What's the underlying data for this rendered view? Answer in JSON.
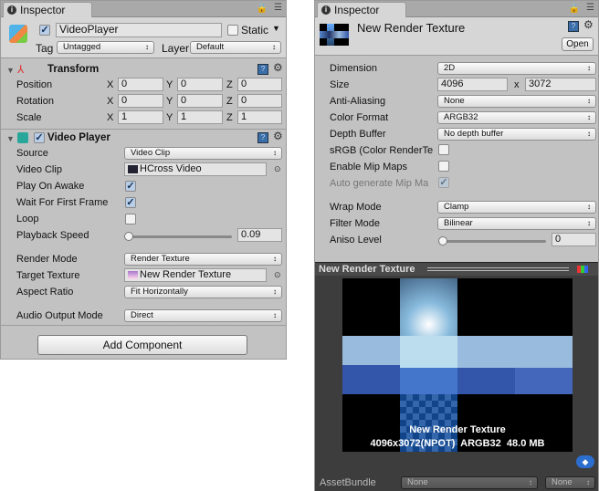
{
  "left": {
    "tab": "Inspector",
    "object_name": "VideoPlayer",
    "object_active": true,
    "static_label": "Static",
    "static": false,
    "tag_label": "Tag",
    "tag_value": "Untagged",
    "layer_label": "Layer",
    "layer_value": "Default",
    "transform": {
      "title": "Transform",
      "rows": [
        {
          "label": "Position",
          "x": "0",
          "y": "0",
          "z": "0"
        },
        {
          "label": "Rotation",
          "x": "0",
          "y": "0",
          "z": "0"
        },
        {
          "label": "Scale",
          "x": "1",
          "y": "1",
          "z": "1"
        }
      ],
      "axis_x": "X",
      "axis_y": "Y",
      "axis_z": "Z"
    },
    "video_player": {
      "title": "Video Player",
      "enabled": true,
      "source_label": "Source",
      "source": "Video Clip",
      "clip_label": "Video Clip",
      "clip": "HCross Video",
      "play_on_awake_label": "Play On Awake",
      "play_on_awake": true,
      "wait_label": "Wait For First Frame",
      "wait": true,
      "loop_label": "Loop",
      "loop": false,
      "speed_label": "Playback Speed",
      "speed": "0.09",
      "render_mode_label": "Render Mode",
      "render_mode": "Render Texture",
      "target_label": "Target Texture",
      "target": "New Render Texture",
      "aspect_label": "Aspect Ratio",
      "aspect": "Fit Horizontally",
      "audio_label": "Audio Output Mode",
      "audio": "Direct"
    },
    "add_component": "Add Component"
  },
  "right": {
    "tab": "Inspector",
    "asset_name": "New Render Texture",
    "open": "Open",
    "dimension_label": "Dimension",
    "dimension": "2D",
    "size_label": "Size",
    "width": "4096",
    "x": "x",
    "height": "3072",
    "aa_label": "Anti-Aliasing",
    "aa": "None",
    "color_format_label": "Color Format",
    "color_format": "ARGB32",
    "depth_label": "Depth Buffer",
    "depth": "No depth buffer",
    "srgb_label": "sRGB (Color RenderTe",
    "srgb": false,
    "mip_label": "Enable Mip Maps",
    "mip": false,
    "auto_mip_label": "Auto generate Mip Ma",
    "auto_mip": true,
    "wrap_label": "Wrap Mode",
    "wrap": "Clamp",
    "filter_label": "Filter Mode",
    "filter": "Bilinear",
    "aniso_label": "Aniso Level",
    "aniso": "0",
    "preview_title": "New Render Texture",
    "preview_name": "New Render Texture",
    "preview_info": "4096x3072(NPOT)  ARGB32  48.0 MB",
    "assetbundle_label": "AssetBundle",
    "assetbundle": "None",
    "variant": "None"
  },
  "colors": {
    "panel": "#c2c2c2",
    "dark": "#3d3d3d",
    "accent": "#3a6ea8"
  }
}
